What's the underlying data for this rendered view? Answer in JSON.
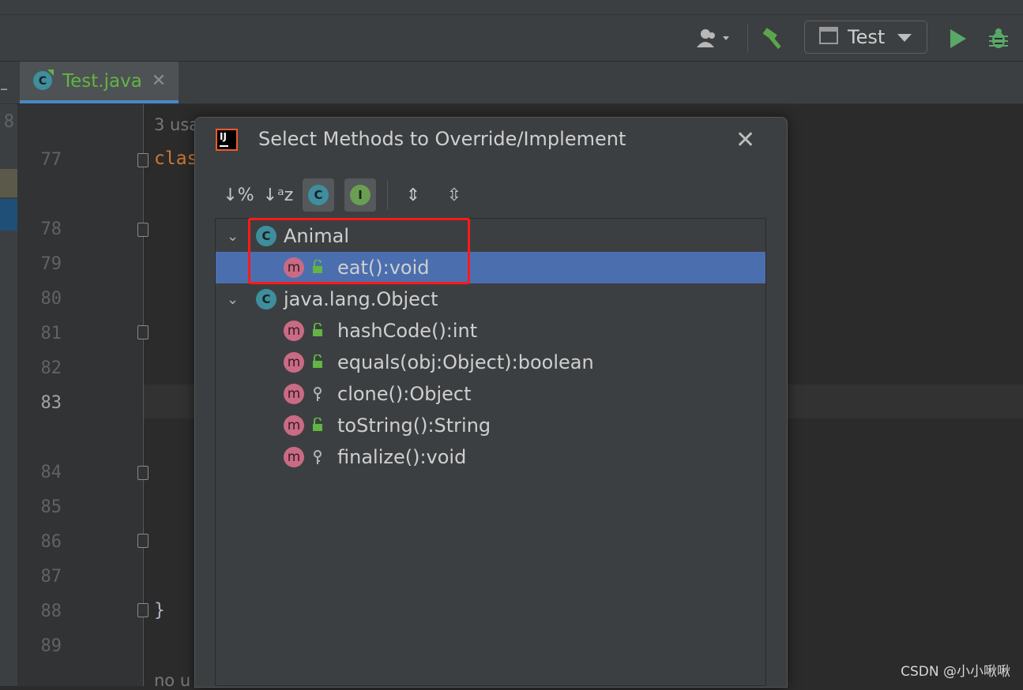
{
  "toolbar": {
    "run_config_label": "Test",
    "icons": [
      "user-icon",
      "build-hammer-icon",
      "window-icon",
      "run-icon",
      "debug-icon"
    ]
  },
  "tabs": [
    {
      "label": "Test.java",
      "close": "✕"
    }
  ],
  "editor": {
    "line_numbers": [
      "8",
      "77",
      "78",
      "79",
      "80",
      "81",
      "82",
      "83",
      "84",
      "85",
      "86",
      "87",
      "88",
      "89"
    ],
    "usages_top": "3 usa",
    "code_keyword": "clas",
    "closing_brace": "}",
    "usages_bottom": "no u"
  },
  "dialog": {
    "title": "Select Methods to Override/Implement",
    "close": "✕",
    "tools": [
      {
        "name": "sort-by-visibility-icon",
        "glyph": "↓%"
      },
      {
        "name": "sort-alphabetically-icon",
        "glyph": "↓ᵃz"
      },
      {
        "name": "show-classes-icon",
        "glyph": "C"
      },
      {
        "name": "show-interfaces-icon",
        "glyph": "I"
      },
      {
        "name": "expand-all-icon",
        "glyph": "⇕"
      },
      {
        "name": "collapse-all-icon",
        "glyph": "⇳"
      }
    ],
    "tree": [
      {
        "type": "class",
        "label": "Animal",
        "expanded": true
      },
      {
        "type": "method",
        "label": "eat():void",
        "visibility": "public",
        "selected": true
      },
      {
        "type": "class",
        "label": "java.lang.Object",
        "expanded": true
      },
      {
        "type": "method",
        "label": "hashCode():int",
        "visibility": "public"
      },
      {
        "type": "method",
        "label": "equals(obj:Object):boolean",
        "visibility": "public"
      },
      {
        "type": "method",
        "label": "clone():Object",
        "visibility": "protected"
      },
      {
        "type": "method",
        "label": "toString():String",
        "visibility": "public"
      },
      {
        "type": "method",
        "label": "finalize():void",
        "visibility": "protected"
      }
    ]
  },
  "colors": {
    "selection": "#4b6eaf",
    "highlight_box": "#ff1a1a",
    "tab_text": "#62b543"
  },
  "watermark": "CSDN @小小啾啾"
}
